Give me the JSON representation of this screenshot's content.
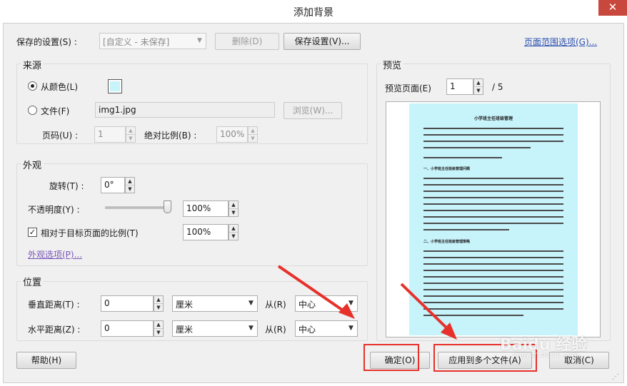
{
  "window": {
    "title": "添加背景",
    "close_glyph": "✕"
  },
  "saved_settings": {
    "label": "保存的设置(S) :",
    "value": "[自定义 - 未保存]",
    "delete_label": "删除(D)",
    "save_label": "保存设置(V)..."
  },
  "page_range_link": "页面范围选项(G)...",
  "source": {
    "title": "来源",
    "from_color_label": "从颜色(L)",
    "color_swatch": "#c7f3fb",
    "file_label": "文件(F)",
    "file_value": "img1.jpg",
    "browse_label": "浏览(W)...",
    "page_label": "页码(U) :",
    "page_value": "1",
    "abs_scale_label": "绝对比例(B) :",
    "abs_scale_value": "100%"
  },
  "appearance": {
    "title": "外观",
    "rotation_label": "旋转(T) :",
    "rotation_value": "0°",
    "opacity_label": "不透明度(Y) :",
    "opacity_value": "100%",
    "opacity_level": 1.0,
    "relative_scale_label": "相对于目标页面的比例(T)",
    "relative_scale_value": "100%",
    "options_link": "外观选项(P)..."
  },
  "position": {
    "title": "位置",
    "vertical_label": "垂直距离(T) :",
    "vertical_value": "0",
    "vertical_unit": "厘米",
    "vertical_from_label": "从(R)",
    "vertical_from_value": "中心",
    "horizontal_label": "水平距离(Z) :",
    "horizontal_value": "0",
    "horizontal_unit": "厘米",
    "horizontal_from_label": "从(R)",
    "horizontal_from_value": "中心"
  },
  "preview": {
    "title": "预览",
    "page_label": "预览页面(E)",
    "page_value": "1",
    "total": "/ 5",
    "page_bg": "#c7f3fb",
    "doc_title": "小学班主任班级管理",
    "doc_section": "一、小学班主任班级管理问题",
    "doc_subsection": "二、小学班主任班级管理策略"
  },
  "footer": {
    "help_label": "帮助(H)",
    "ok_label": "确定(O)",
    "apply_multiple_label": "应用到多个文件(A)",
    "cancel_label": "取消(C)"
  },
  "watermark": {
    "text": "Baidu 经验",
    "subtext": "jingyan.baidu.com"
  },
  "colors": {
    "annotation_red": "#e8302a",
    "link_blue": "#2a50b0"
  }
}
